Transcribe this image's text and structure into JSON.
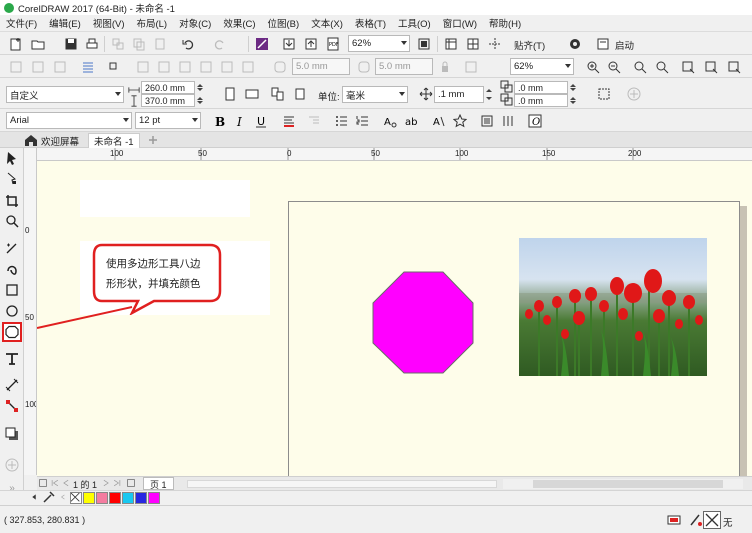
{
  "window": {
    "title": "CorelDRAW 2017 (64-Bit) - 未命名 -1"
  },
  "menu": [
    "文件(F)",
    "编辑(E)",
    "视图(V)",
    "布局(L)",
    "对象(C)",
    "效果(C)",
    "位图(B)",
    "文本(X)",
    "表格(T)",
    "工具(O)",
    "窗口(W)",
    "帮助(H)"
  ],
  "toolbar_standard": {
    "zoom": "62%",
    "snap_label": "贴齐(T)",
    "launch_label": "启动"
  },
  "toolbar_dimmed": {
    "w_value": "5.0 mm",
    "h_value": "5.0 mm",
    "zoom": "62%"
  },
  "property_bar": {
    "paper_preset": "自定义",
    "width": "260.0 mm",
    "height": "370.0 mm",
    "unit_label": "单位:",
    "unit_value": "毫米",
    "nudge": ".1 mm",
    "dup_x": ".0 mm",
    "dup_y": ".0 mm"
  },
  "text_bar": {
    "font": "Arial",
    "size": "12 pt"
  },
  "tabs": [
    {
      "label": "欢迎屏幕"
    },
    {
      "label": "未命名 -1"
    }
  ],
  "rulers": {
    "h_ticks": [
      "100",
      "50",
      "0",
      "50",
      "100",
      "150",
      "200"
    ],
    "v_ticks": [
      "0",
      "50",
      "100"
    ]
  },
  "callout": {
    "line1": "使用多边形工具八边",
    "line2": "形形状，并填充颜色"
  },
  "octagon_color": "#ff00ff",
  "page_nav": {
    "page_indicator": "1 的 1",
    "page_tab": "页 1"
  },
  "palette_colors": [
    "#ffff00",
    "#f47ca0",
    "#ff0000",
    "#18c8f0",
    "#2828e0",
    "#ff00ff"
  ],
  "status": {
    "coords": "( 327.853, 280.831 )",
    "fill_none": "无"
  }
}
